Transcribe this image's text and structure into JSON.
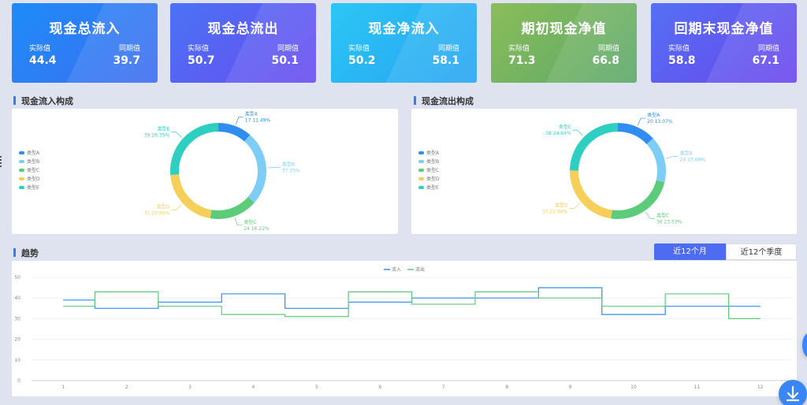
{
  "kpis": [
    {
      "title": "现金总流入",
      "actual_label": "实际值",
      "actual": "44.4",
      "prior_label": "同期值",
      "prior": "39.7",
      "gradient": [
        "#1d8cf8",
        "#3f6df0"
      ]
    },
    {
      "title": "现金总流出",
      "actual_label": "实际值",
      "actual": "50.7",
      "prior_label": "同期值",
      "prior": "50.1",
      "gradient": [
        "#4a73f5",
        "#6a4bf0"
      ]
    },
    {
      "title": "现金净流入",
      "actual_label": "实际值",
      "actual": "50.2",
      "prior_label": "同期值",
      "prior": "58.1",
      "gradient": [
        "#2cc6f5",
        "#27a3f2"
      ]
    },
    {
      "title": "期初现金净值",
      "actual_label": "实际值",
      "actual": "71.3",
      "prior_label": "同期值",
      "prior": "66.8",
      "gradient": [
        "#8bbd5a",
        "#5aa86a"
      ]
    },
    {
      "title": "回期末现金净值",
      "actual_label": "实际值",
      "actual": "58.8",
      "prior_label": "同期值",
      "prior": "67.1",
      "gradient": [
        "#5470f3",
        "#6b45ee"
      ]
    }
  ],
  "donut_legend": [
    "类型A",
    "类型B",
    "类型C",
    "类型D",
    "类型E"
  ],
  "type_colors": [
    "#2f8cf0",
    "#7dcdf7",
    "#5ccb7a",
    "#f6cf5a",
    "#2ecfc0"
  ],
  "inflow": {
    "title": "现金流入构成",
    "slices": [
      {
        "name": "类型A",
        "value": 17,
        "pct": "11.49%"
      },
      {
        "name": "类型B",
        "value": 37,
        "pct": "25%"
      },
      {
        "name": "类型C",
        "value": 24,
        "pct": "16.22%"
      },
      {
        "name": "类型D",
        "value": 31,
        "pct": "20.95%"
      },
      {
        "name": "类型E",
        "value": 39,
        "pct": "26.35%"
      }
    ]
  },
  "outflow": {
    "title": "现金流出构成",
    "slices": [
      {
        "name": "类型A",
        "value": 20,
        "pct": "13.07%"
      },
      {
        "name": "类型B",
        "value": 24,
        "pct": "15.69%"
      },
      {
        "name": "类型C",
        "value": 36,
        "pct": "23.53%"
      },
      {
        "name": "类型D",
        "value": 35,
        "pct": "22.88%"
      },
      {
        "name": "类型E",
        "value": 38,
        "pct": "24.84%"
      }
    ]
  },
  "trend": {
    "title": "趋势",
    "toggle": [
      "近12个月",
      "近12个季度"
    ],
    "active_toggle": 0
  },
  "chart_data": [
    {
      "type": "pie",
      "categories": [
        "类型A",
        "类型B",
        "类型C",
        "类型D",
        "类型E"
      ],
      "values": [
        17,
        37,
        24,
        31,
        39
      ],
      "title": "现金流入构成"
    },
    {
      "type": "pie",
      "categories": [
        "类型A",
        "类型B",
        "类型C",
        "类型D",
        "类型E"
      ],
      "values": [
        20,
        24,
        36,
        35,
        38
      ],
      "title": "现金流出构成"
    },
    {
      "type": "line",
      "title": "趋势",
      "x": [
        1,
        2,
        3,
        4,
        5,
        6,
        7,
        8,
        9,
        10,
        11,
        12
      ],
      "ylim": [
        0,
        50
      ],
      "yticks": [
        0,
        10,
        20,
        30,
        40,
        50
      ],
      "step": true,
      "legend_position": "top",
      "series": [
        {
          "name": "流入",
          "color": "#2f8cf0",
          "values": [
            39,
            35,
            38,
            42,
            35,
            38,
            40,
            40,
            45,
            32,
            36,
            36
          ]
        },
        {
          "name": "流出",
          "color": "#5ccb7a",
          "values": [
            36,
            43,
            36,
            32,
            31,
            43,
            37,
            43,
            40,
            36,
            42,
            30
          ]
        }
      ]
    }
  ]
}
